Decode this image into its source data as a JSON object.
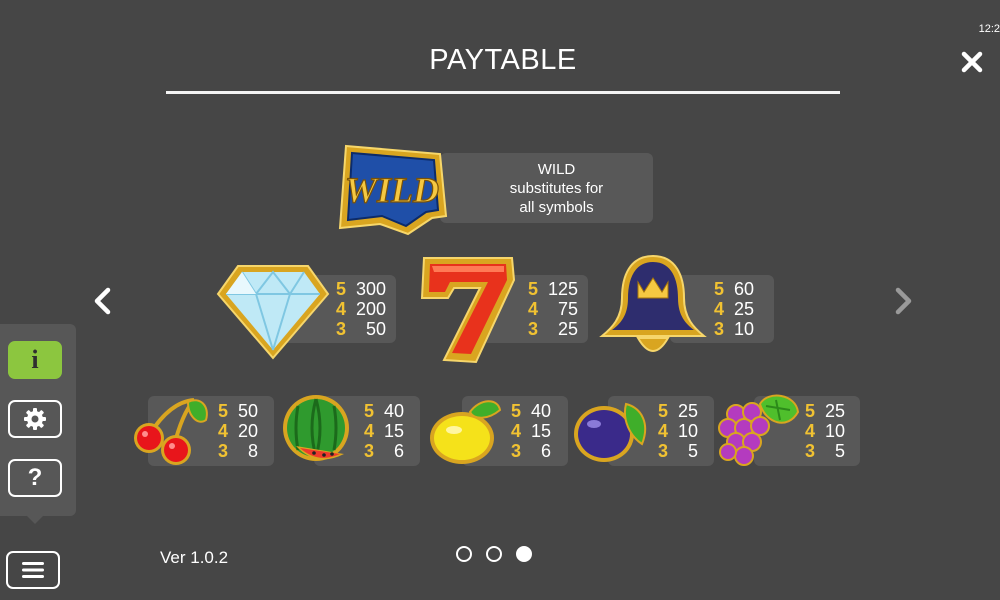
{
  "status": {
    "clock": "12:2"
  },
  "header": {
    "title": "PAYTABLE"
  },
  "wild": {
    "logo_text": "WILD",
    "title": "WILD",
    "line1": "substitutes for",
    "line2": "all symbols"
  },
  "row1": [
    {
      "symbol": "diamond-icon",
      "pays": [
        {
          "count": "5",
          "value": "300"
        },
        {
          "count": "4",
          "value": "200"
        },
        {
          "count": "3",
          "value": "50"
        }
      ]
    },
    {
      "symbol": "seven-icon",
      "pays": [
        {
          "count": "5",
          "value": "125"
        },
        {
          "count": "4",
          "value": "75"
        },
        {
          "count": "3",
          "value": "25"
        }
      ]
    },
    {
      "symbol": "bell-icon",
      "pays": [
        {
          "count": "5",
          "value": "60"
        },
        {
          "count": "4",
          "value": "25"
        },
        {
          "count": "3",
          "value": "10"
        }
      ]
    }
  ],
  "row2": [
    {
      "symbol": "cherries-icon",
      "pays": [
        {
          "count": "5",
          "value": "50"
        },
        {
          "count": "4",
          "value": "20"
        },
        {
          "count": "3",
          "value": "8"
        }
      ]
    },
    {
      "symbol": "watermelon-icon",
      "pays": [
        {
          "count": "5",
          "value": "40"
        },
        {
          "count": "4",
          "value": "15"
        },
        {
          "count": "3",
          "value": "6"
        }
      ]
    },
    {
      "symbol": "lemon-icon",
      "pays": [
        {
          "count": "5",
          "value": "40"
        },
        {
          "count": "4",
          "value": "15"
        },
        {
          "count": "3",
          "value": "6"
        }
      ]
    },
    {
      "symbol": "plum-icon",
      "pays": [
        {
          "count": "5",
          "value": "25"
        },
        {
          "count": "4",
          "value": "10"
        },
        {
          "count": "3",
          "value": "5"
        }
      ]
    },
    {
      "symbol": "grapes-icon",
      "pays": [
        {
          "count": "5",
          "value": "25"
        },
        {
          "count": "4",
          "value": "10"
        },
        {
          "count": "3",
          "value": "5"
        }
      ]
    }
  ],
  "sidebar": {
    "info_label": "i",
    "help_label": "?"
  },
  "footer": {
    "version": "Ver 1.0.2",
    "pages": 3,
    "current_page": 3
  },
  "colors": {
    "background": "#464646",
    "panel": "#585858",
    "accent_green": "#8cc63f",
    "count_yellow": "#f1c232"
  }
}
